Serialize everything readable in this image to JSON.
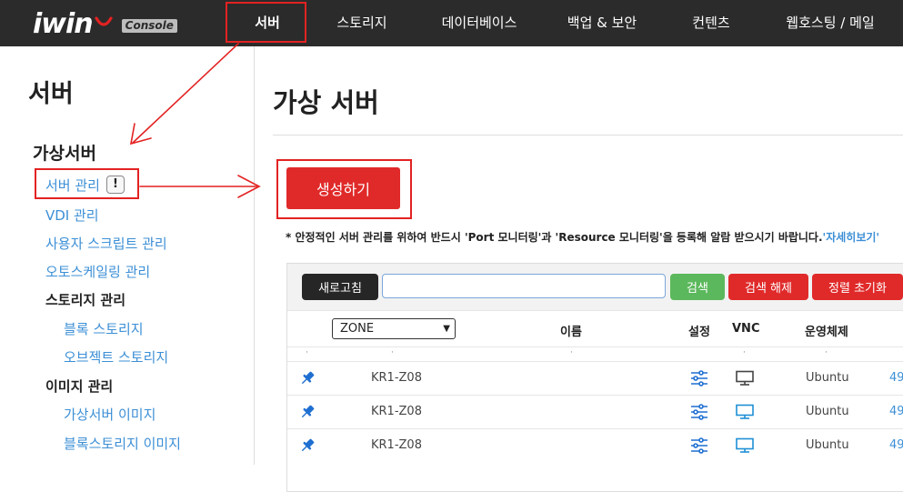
{
  "brand": {
    "logo_text": "iwin",
    "badge": "Console"
  },
  "nav": [
    {
      "label": "서버"
    },
    {
      "label": "스토리지"
    },
    {
      "label": "데이터베이스"
    },
    {
      "label": "백업 & 보안"
    },
    {
      "label": "컨텐츠"
    },
    {
      "label": "웹호스팅 / 메일"
    }
  ],
  "sidebar": {
    "title": "서버",
    "group": "가상서버",
    "items": {
      "server_manage": "서버 관리",
      "vdi": "VDI 관리",
      "user_script": "사용자 스크립트 관리",
      "autoscaling": "오토스케일링 관리",
      "storage_header": "스토리지 관리",
      "block_storage": "블록 스토리지",
      "object_storage": "오브젝트 스토리지",
      "image_header": "이미지 관리",
      "vm_image": "가상서버 이미지",
      "block_image": "블록스토리지 이미지"
    },
    "warn_badge": "!"
  },
  "main": {
    "title": "가상 서버",
    "create_button": "생성하기",
    "notice_text": "* 안정적인 서버 관리를 위하여 반드시 'Port 모니터링'과 'Resource 모니터링'을 등록해 알람 받으시기 바랍니다.",
    "notice_link": "'자세히보기'"
  },
  "toolbar": {
    "refresh": "새로고침",
    "search_value": "",
    "search": "검색",
    "clear_search": "검색 해제",
    "reset_sort": "정렬 초기화"
  },
  "table": {
    "zone_select": "ZONE",
    "headers": {
      "name": "이름",
      "settings": "설정",
      "vnc": "VNC",
      "os": "운영체제"
    },
    "rows": [
      {
        "zone": "KR1-Z08",
        "os": "Ubuntu",
        "num": "49"
      },
      {
        "zone": "KR1-Z08",
        "os": "Ubuntu",
        "num": "49"
      },
      {
        "zone": "KR1-Z08",
        "os": "Ubuntu",
        "num": "49"
      }
    ]
  },
  "colors": {
    "topbar": "#2b2b2b",
    "accent_red": "#e02a2a",
    "link_blue": "#3c8fd6",
    "annotation_red": "#e32222",
    "search_green": "#5cb85c"
  }
}
